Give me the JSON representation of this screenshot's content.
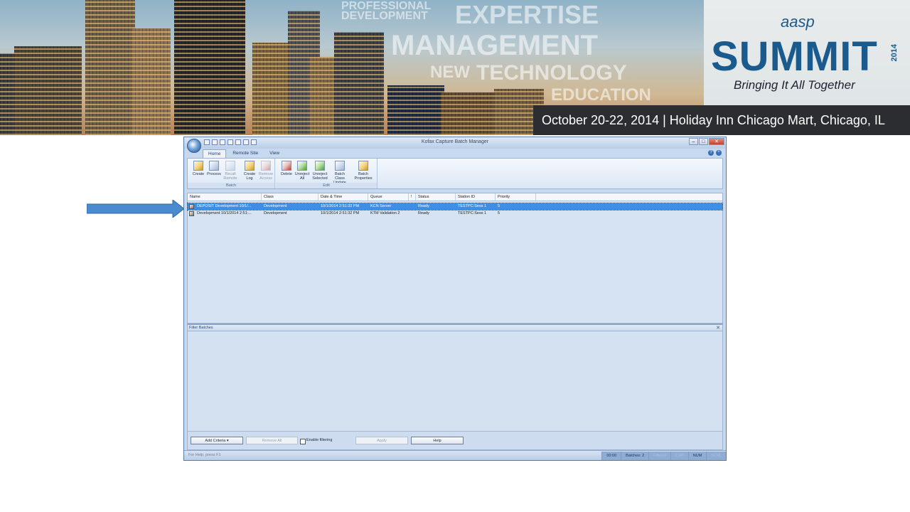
{
  "banner": {
    "words": [
      "PROFESSIONAL",
      "DEVELOPMENT",
      "EXPERTISE",
      "MANAGEMENT",
      "NEW",
      "TECHNOLOGY",
      "EDUCATION"
    ],
    "logo_small": "aasp",
    "logo_big": "SUMMIT",
    "logo_year": "2014",
    "tagline": "Bringing It All Together",
    "event_line": "October 20-22, 2014 | Holiday Inn Chicago Mart, Chicago, IL"
  },
  "window": {
    "title": "Kofax Capture Batch Manager",
    "tabs": [
      "Home",
      "Remote Site",
      "View"
    ],
    "ribbon": {
      "batch_group": "Batch",
      "edit_group": "Edit",
      "create": "Create",
      "process": "Process",
      "recall_remote": "Recall Remote",
      "create_log": "Create Log",
      "remove_access": "Remove Access",
      "delete": "Delete",
      "unreject_all": "Unreject All",
      "unreject_selected": "Unreject Selected",
      "batch_class_update": "Batch Class Update",
      "batch_properties": "Batch Properties"
    },
    "columns": {
      "name": "Name",
      "class": "Class",
      "datetime": "Date & Time",
      "queue": "Queue",
      "sort": "!",
      "status": "Status",
      "station": "Station ID",
      "priority": "Priority"
    },
    "rows": [
      {
        "name": "DEPOSIT Development 10/1/...",
        "class": "Development",
        "datetime": "10/1/2014 2:51:32 PM",
        "queue": "KCN Server",
        "status": "Ready",
        "station": "TESTPC:Sess 1",
        "priority": "5"
      },
      {
        "name": "Development 10/1/2014 2:51:...",
        "class": "Development",
        "datetime": "10/1/2014 2:51:32 PM",
        "queue": "KTM Validation 2",
        "status": "Ready",
        "station": "TESTPC:Sess 1",
        "priority": "5"
      }
    ],
    "filter": {
      "title": "Filter Batches",
      "add_criteria": "Add Criteria",
      "remove_all": "Remove All",
      "enable_filtering": "Enable filtering",
      "apply": "Apply",
      "help": "Help"
    },
    "status": {
      "help_text": "For Help, press F1",
      "time": "00:00",
      "batches": "Batches: 2",
      "filtered": "Filtered",
      "cap": "CAP",
      "num": "NUM",
      "scrl": "SCRL"
    }
  },
  "colors": {
    "selection": "#3d8ee6",
    "arrow": "#4a8bcf",
    "logo": "#1a5a8c",
    "date_bar": "#2b2d30"
  }
}
